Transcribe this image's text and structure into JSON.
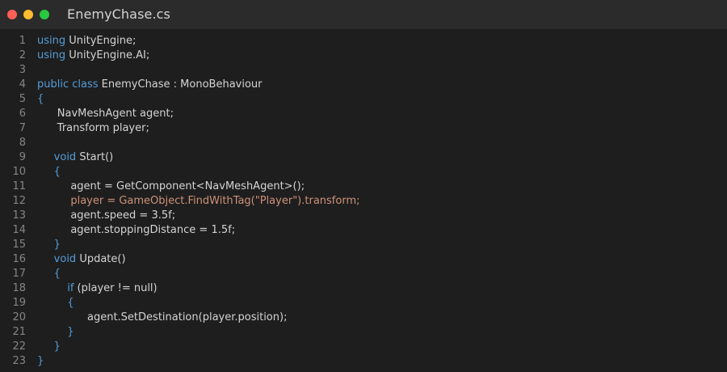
{
  "window": {
    "title": "EnemyChase.cs",
    "traffic_colors": {
      "close": "#ff5f57",
      "minimize": "#febc2e",
      "zoom": "#28c840"
    }
  },
  "editor": {
    "colors": {
      "background": "#1e1e1e",
      "keyword": "#569cd6",
      "text": "#d4d4d4",
      "highlighted": "#ce9178",
      "line_number": "#858585"
    },
    "lines": [
      {
        "n": "1",
        "indent": "",
        "tokens": [
          {
            "t": "using",
            "c": "kw"
          },
          {
            "t": " UnityEngine;",
            "c": "plain"
          }
        ]
      },
      {
        "n": "2",
        "indent": "",
        "tokens": [
          {
            "t": "using",
            "c": "kw"
          },
          {
            "t": " UnityEngine.AI;",
            "c": "plain"
          }
        ]
      },
      {
        "n": "3",
        "indent": "",
        "tokens": []
      },
      {
        "n": "4",
        "indent": "",
        "tokens": [
          {
            "t": "public",
            "c": "kw"
          },
          {
            "t": " ",
            "c": "plain"
          },
          {
            "t": "class",
            "c": "kw"
          },
          {
            "t": " EnemyChase : MonoBehaviour",
            "c": "plain"
          }
        ]
      },
      {
        "n": "5",
        "indent": "",
        "tokens": [
          {
            "t": "{",
            "c": "brace"
          }
        ]
      },
      {
        "n": "6",
        "indent": "      ",
        "tokens": [
          {
            "t": "NavMeshAgent agent;",
            "c": "plain"
          }
        ]
      },
      {
        "n": "7",
        "indent": "      ",
        "tokens": [
          {
            "t": "Transform player;",
            "c": "plain"
          }
        ]
      },
      {
        "n": "8",
        "indent": "",
        "tokens": []
      },
      {
        "n": "9",
        "indent": "     ",
        "tokens": [
          {
            "t": "void",
            "c": "kw"
          },
          {
            "t": " Start()",
            "c": "plain"
          }
        ]
      },
      {
        "n": "10",
        "indent": "     ",
        "tokens": [
          {
            "t": "{",
            "c": "brace"
          }
        ]
      },
      {
        "n": "11",
        "indent": "          ",
        "tokens": [
          {
            "t": "agent = GetComponent<NavMeshAgent>();",
            "c": "plain"
          }
        ]
      },
      {
        "n": "12",
        "indent": "          ",
        "tokens": [
          {
            "t": "player = GameObject.FindWithTag(\"Player\").transform;",
            "c": "hl"
          }
        ]
      },
      {
        "n": "13",
        "indent": "          ",
        "tokens": [
          {
            "t": "agent.speed = 3.5f;",
            "c": "plain"
          }
        ]
      },
      {
        "n": "14",
        "indent": "          ",
        "tokens": [
          {
            "t": "agent.stoppingDistance = 1.5f;",
            "c": "plain"
          }
        ]
      },
      {
        "n": "15",
        "indent": "     ",
        "tokens": [
          {
            "t": "}",
            "c": "brace"
          }
        ]
      },
      {
        "n": "16",
        "indent": "     ",
        "tokens": [
          {
            "t": "void",
            "c": "kw"
          },
          {
            "t": " Update()",
            "c": "plain"
          }
        ]
      },
      {
        "n": "17",
        "indent": "     ",
        "tokens": [
          {
            "t": "{",
            "c": "brace"
          }
        ]
      },
      {
        "n": "18",
        "indent": "         ",
        "tokens": [
          {
            "t": "if",
            "c": "kw"
          },
          {
            "t": " (player != null)",
            "c": "plain"
          }
        ]
      },
      {
        "n": "19",
        "indent": "         ",
        "tokens": [
          {
            "t": "{",
            "c": "brace"
          }
        ]
      },
      {
        "n": "20",
        "indent": "               ",
        "tokens": [
          {
            "t": "agent.SetDestination(player.position);",
            "c": "plain"
          }
        ]
      },
      {
        "n": "21",
        "indent": "         ",
        "tokens": [
          {
            "t": "}",
            "c": "brace"
          }
        ]
      },
      {
        "n": "22",
        "indent": "     ",
        "tokens": [
          {
            "t": "}",
            "c": "brace"
          }
        ]
      },
      {
        "n": "23",
        "indent": "",
        "tokens": [
          {
            "t": "}",
            "c": "brace"
          }
        ]
      }
    ]
  }
}
